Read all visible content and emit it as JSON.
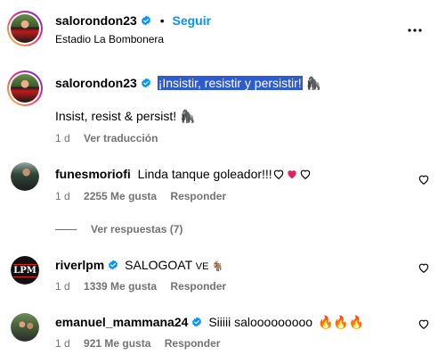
{
  "header": {
    "username": "salorondon23",
    "separator": "•",
    "follow_label": "Seguir",
    "location": "Estadio La Bombonera"
  },
  "caption": {
    "username": "salorondon23",
    "text": "¡Insistir, resistir y persistir!",
    "emoji": "🦍",
    "translation": "Insist, resist & persist!",
    "translation_emoji": "🦍",
    "time": "1 d",
    "see_translation": "Ver traducción"
  },
  "comments": [
    {
      "username": "funesmoriofi",
      "text": "Linda tanque goleador!!!",
      "time": "1 d",
      "likes": "2255 Me gusta",
      "reply": "Responder",
      "view_replies": "Ver respuestas (7)"
    },
    {
      "username": "riverlpm",
      "text": "SALOGOAT",
      "emoji": "VE 🐐",
      "avatar_text": "LPM",
      "time": "1 d",
      "likes": "1339 Me gusta",
      "reply": "Responder"
    },
    {
      "username": "emanuel_mammana24",
      "text": "Siiiii salooooooooo",
      "emoji": "🔥🔥🔥",
      "time": "1 d",
      "likes": "921 Me gusta",
      "reply": "Responder"
    }
  ],
  "colors": {
    "accent": "#0095f6",
    "verified": "#0095f6",
    "selection": "#2f5bd0",
    "muted": "#737373",
    "heart_red": "#e0245e"
  },
  "icons": [
    "more-options-icon",
    "verified-badge-icon",
    "heart-outline-icon",
    "heart-filled-icon",
    "like-heart-icon"
  ]
}
